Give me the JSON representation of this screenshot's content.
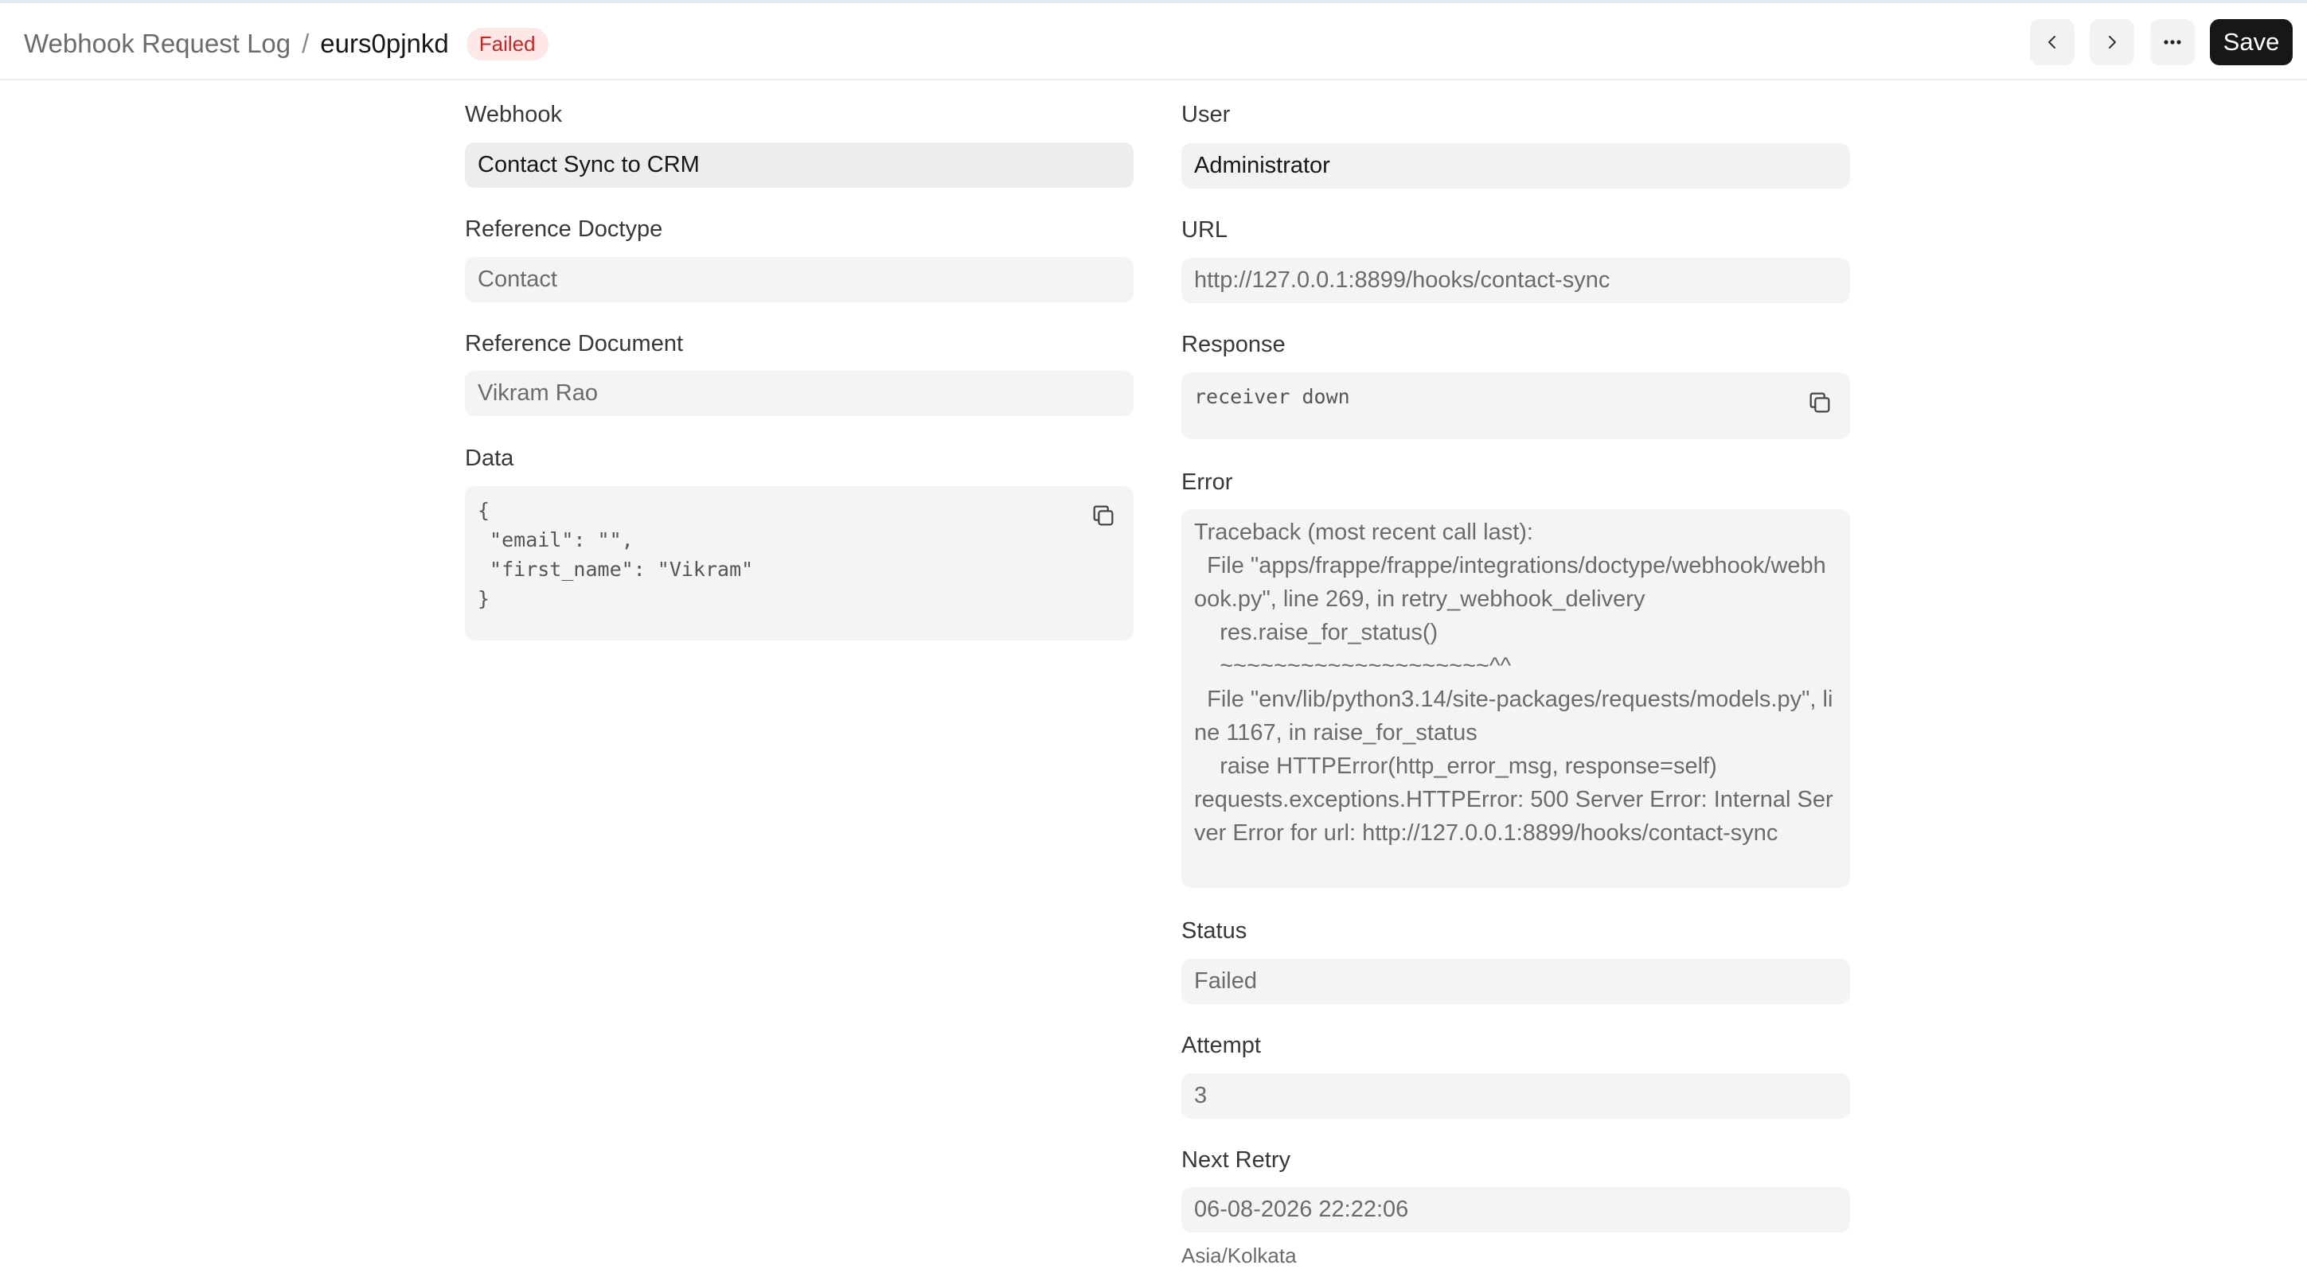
{
  "header": {
    "breadcrumb_parent": "Webhook Request Log",
    "breadcrumb_separator": "/",
    "doc_name": "eurs0pjnkd",
    "status_badge": "Failed",
    "save_label": "Save"
  },
  "fields": {
    "webhook": {
      "label": "Webhook",
      "value": "Contact Sync to CRM"
    },
    "reference_doctype": {
      "label": "Reference Doctype",
      "value": "Contact"
    },
    "reference_document": {
      "label": "Reference Document",
      "value": "Vikram Rao"
    },
    "data": {
      "label": "Data",
      "value": "{\n \"email\": \"\",\n \"first_name\": \"Vikram\"\n}"
    },
    "user": {
      "label": "User",
      "value": "Administrator"
    },
    "url": {
      "label": "URL",
      "value": "http://127.0.0.1:8899/hooks/contact-sync"
    },
    "response": {
      "label": "Response",
      "value": "receiver down"
    },
    "error": {
      "label": "Error",
      "value": "Traceback (most recent call last):\n  File \"apps/frappe/frappe/integrations/doctype/webhook/webhook.py\", line 269, in retry_webhook_delivery\n    res.raise_for_status()\n    ~~~~~~~~~~~~~~~~~~~~^^\n  File \"env/lib/python3.14/site-packages/requests/models.py\", line 1167, in raise_for_status\n    raise HTTPError(http_error_msg, response=self)\nrequests.exceptions.HTTPError: 500 Server Error: Internal Server Error for url: http://127.0.0.1:8899/hooks/contact-sync"
    },
    "status": {
      "label": "Status",
      "value": "Failed"
    },
    "attempt": {
      "label": "Attempt",
      "value": "3"
    },
    "next_retry": {
      "label": "Next Retry",
      "value": "06-08-2026 22:22:06",
      "timezone": "Asia/Kolkata"
    }
  },
  "icons": {
    "prev": "chevron-left-icon",
    "next": "chevron-right-icon",
    "more": "more-horizontal-icon",
    "copy": "copy-icon"
  }
}
